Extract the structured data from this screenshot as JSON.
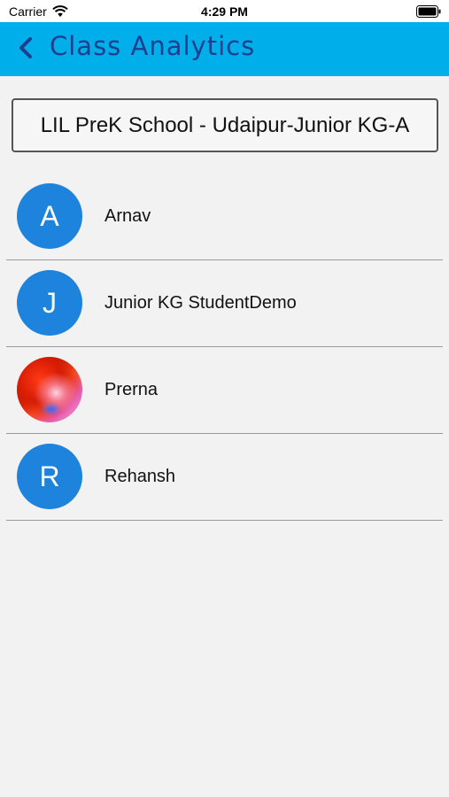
{
  "status_bar": {
    "carrier": "Carrier",
    "time": "4:29 PM"
  },
  "header": {
    "title": "Class Analytics",
    "background": "#00aee9",
    "title_color": "#1d3f8f"
  },
  "class_selector": {
    "value": "LIL PreK School - Udaipur-Junior KG-A"
  },
  "students": [
    {
      "initial": "A",
      "name": "Arnav",
      "avatar": "initial"
    },
    {
      "initial": "J",
      "name": "Junior KG StudentDemo",
      "avatar": "initial"
    },
    {
      "initial": "",
      "name": "Prerna",
      "avatar": "photo"
    },
    {
      "initial": "R",
      "name": "Rehansh",
      "avatar": "initial"
    }
  ],
  "colors": {
    "avatar": "#1e83dc",
    "divider": "#9a9a9a"
  }
}
